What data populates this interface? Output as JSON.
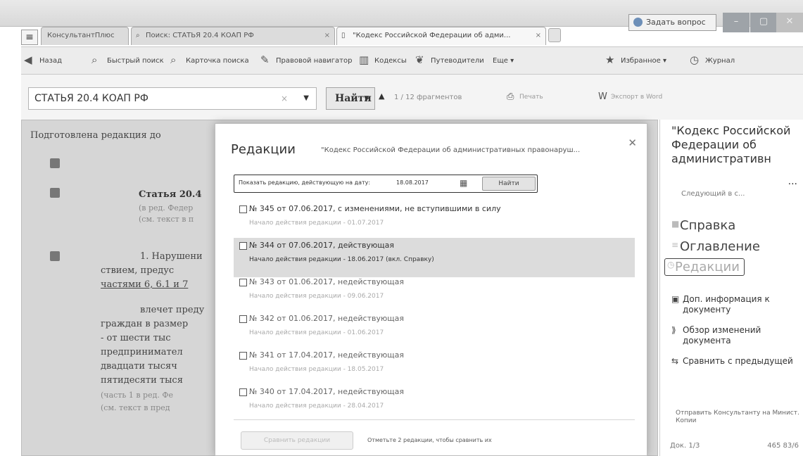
{
  "window": {
    "ask_question": "Задать вопрос",
    "menu_glyph": "≡"
  },
  "tabs": [
    {
      "label": "КонсультантПлюс"
    },
    {
      "label": "Поиск: СТАТЬЯ 20.4 КОАП РФ"
    },
    {
      "label": "\"Кодекс Российской Федерации об адми..."
    }
  ],
  "toolbar": {
    "items": [
      {
        "label": "Назад",
        "icon": "back-arrow-icon",
        "glyph": "◀"
      },
      {
        "label": "Быстрый поиск",
        "icon": "search-icon",
        "glyph": "⌕"
      },
      {
        "label": "Карточка поиска",
        "icon": "card-search-icon",
        "glyph": "⌕"
      },
      {
        "label": "Правовой навигатор",
        "icon": "navigator-icon",
        "glyph": "✎"
      },
      {
        "label": "Кодексы",
        "icon": "codes-icon",
        "glyph": "▥"
      },
      {
        "label": "Путеводители",
        "icon": "guides-icon",
        "glyph": "❦"
      },
      {
        "label": "Еще ▾",
        "icon": "more-icon",
        "glyph": ""
      },
      {
        "label": "Избранное ▾",
        "icon": "star-icon",
        "glyph": "★"
      },
      {
        "label": "Журнал",
        "icon": "history-icon",
        "glyph": "◷"
      }
    ]
  },
  "search": {
    "query": "СТАТЬЯ 20.4 КОАП РФ",
    "find_label": "Найти",
    "count": "1 / 12 фрагментов",
    "print_label": "Печать",
    "word_label": "Экспорт в Word"
  },
  "document": {
    "lines": [
      "Подготовлена редакция до",
      "Статья 20.4",
      "(в ред. Федер",
      "(см. текст в п",
      "1. Нарушени",
      "ствием, предус",
      "частями 6, 6.1 и 7",
      "влечет преду",
      "граждан в размер",
      "- от шести тыс",
      "предпринимател",
      "двадцати тысяч",
      "пятидесяти тыся",
      "(часть 1 в ред. Фе",
      "(см. текст в пред"
    ]
  },
  "right_panel": {
    "title": "\"Кодекс Российской Федерации об административн",
    "more": "...",
    "next_label": "Следующий в с...",
    "help": "Справка",
    "toc": "Оглавление",
    "editions": "Редакции",
    "extra_info": "Доп. информация к документу",
    "changes_review": "Обзор изменений документа",
    "compare": "Сравнить с предыдущей",
    "send": "Отправить Консультанту на Минист. Копии",
    "doc_page": "Док. 1/3",
    "position": "465 83/6"
  },
  "modal": {
    "title": "Редакции",
    "subtitle": "\"Кодекс Российской Федерации об административных правонаруш...",
    "filter_label": "Показать редакцию, действующую на дату:",
    "filter_date": "18.08.2017",
    "find_label": "Найти",
    "editions": [
      {
        "label": "№ 345 от 07.06.2017, с изменениями, не вступившими в силу",
        "sub": "Начало действия редакции - 01.07.2017"
      },
      {
        "label": "№ 344 от 07.06.2017, действующая",
        "sub": "Начало действия редакции - 18.06.2017 (вкл. Справку)"
      },
      {
        "label": "№ 343 от 01.06.2017, недействующая",
        "sub": "Начало действия редакции - 09.06.2017"
      },
      {
        "label": "№ 342 от 01.06.2017, недействующая",
        "sub": "Начало действия редакции - 01.06.2017"
      },
      {
        "label": "№ 341 от 17.04.2017, недействующая",
        "sub": "Начало действия редакции - 18.05.2017"
      },
      {
        "label": "№ 340 от 17.04.2017, недействующая",
        "sub": "Начало действия редакции - 28.04.2017"
      }
    ],
    "compare_btn": "Сравнить редакции",
    "compare_hint": "Отметьте 2 редакции, чтобы сравнить их"
  }
}
